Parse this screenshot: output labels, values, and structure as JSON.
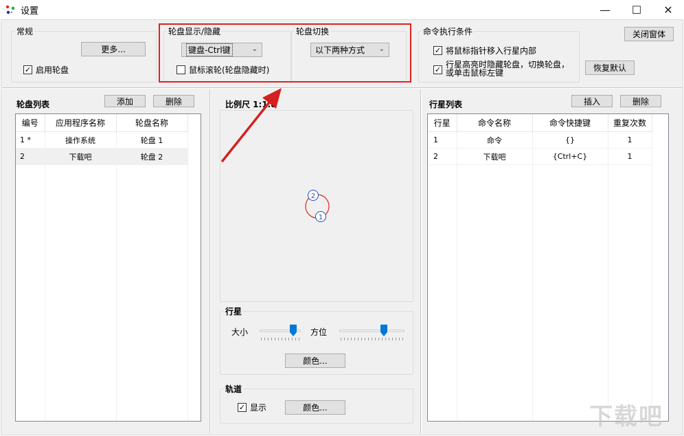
{
  "window": {
    "title": "设置"
  },
  "controls": {
    "minimize": "—",
    "maximize": "☐",
    "close": "✕"
  },
  "general": {
    "label": "常规",
    "more_button": "更多...",
    "enable_wheel": "启用轮盘",
    "enable_wheel_checked": true
  },
  "wheel_display": {
    "label": "轮盘显示/隐藏",
    "combo_value": "键盘-Ctrl键",
    "mouse_scroll": "鼠标滚轮(轮盘隐藏时)",
    "mouse_scroll_checked": false
  },
  "wheel_switch": {
    "label": "轮盘切换",
    "combo_value": "以下两种方式"
  },
  "command_conditions": {
    "label": "命令执行条件",
    "opt1": "将鼠标指针移入行星内部",
    "opt1_checked": true,
    "opt2_line1": "行星高亮时隐藏轮盘，切换轮盘，",
    "opt2_line2": "或单击鼠标左键",
    "opt2_checked": true
  },
  "buttons": {
    "close_window": "关闭窗体",
    "restore_default": "恢复默认"
  },
  "wheel_list": {
    "title": "轮盘列表",
    "add": "添加",
    "delete": "删除",
    "columns": [
      "编号",
      "应用程序名称",
      "轮盘名称"
    ],
    "rows": [
      [
        "1 *",
        "操作系统",
        "轮盘 1"
      ],
      [
        "2",
        "下载吧",
        "轮盘 2"
      ]
    ]
  },
  "preview": {
    "scale_label": "比例尺 1:1.8",
    "node1": "1",
    "node2": "2"
  },
  "planet": {
    "label": "行星",
    "size": "大小",
    "direction": "方位",
    "color": "颜色...",
    "size_level": 0.88,
    "direction_level": 0.71
  },
  "orbit": {
    "label": "轨道",
    "show": "显示",
    "show_checked": true,
    "color": "颜色..."
  },
  "planet_list": {
    "title": "行星列表",
    "insert": "插入",
    "delete": "删除",
    "columns": [
      "行星",
      "命令名称",
      "命令快捷键",
      "重复次数"
    ],
    "rows": [
      [
        "1",
        "命令",
        "{}",
        "1"
      ],
      [
        "2",
        "下载吧",
        "{Ctrl+C}",
        "1"
      ]
    ]
  },
  "watermark": "下载吧",
  "colors": {
    "highlight": "#e02020",
    "slider": "#0078d7",
    "node": "#2050c0"
  }
}
